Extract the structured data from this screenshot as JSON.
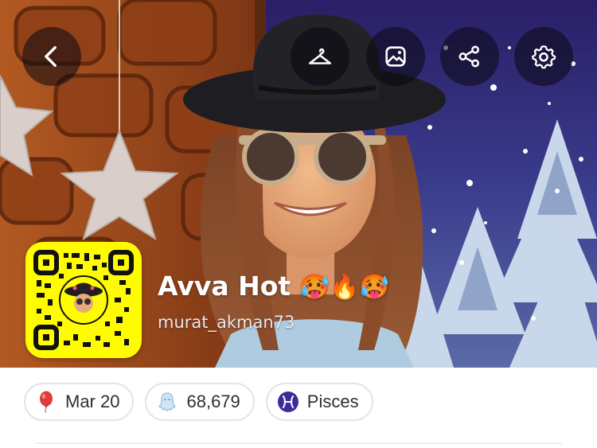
{
  "profile": {
    "display_name": "Avva Hot",
    "name_emojis": [
      "🥵",
      "🔥",
      "🥵"
    ],
    "username": "murat_akman73"
  },
  "toolbar": {
    "back": "back-icon",
    "buttons": [
      "hanger-icon",
      "photo-icon",
      "share-icon",
      "gear-icon"
    ]
  },
  "chips": [
    {
      "icon": "balloon-icon",
      "label": "Mar 20"
    },
    {
      "icon": "ghost-icon",
      "label": "68,679"
    },
    {
      "icon": "pisces-icon",
      "label": "Pisces"
    }
  ],
  "colors": {
    "snapcode": "#FFFC00",
    "pisces": "#3f2a9a",
    "balloon": "#e23b3b",
    "ghost": "#9ec6ea"
  }
}
